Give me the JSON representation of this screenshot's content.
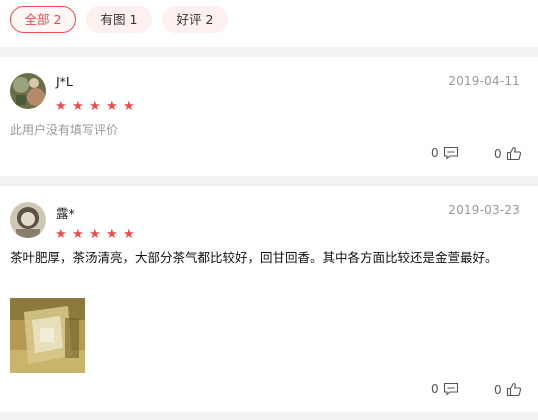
{
  "filters": [
    {
      "label": "全部 2",
      "active": true
    },
    {
      "label": "有图 1",
      "active": false
    },
    {
      "label": "好评 2",
      "active": false
    }
  ],
  "reviews": [
    {
      "user": "J*L",
      "date": "2019-04-11",
      "rating": 5,
      "text": "此用户没有填写评价",
      "has_photo": false,
      "comments": "0",
      "likes": "0"
    },
    {
      "user": "露*",
      "date": "2019-03-23",
      "rating": 5,
      "text": "茶叶肥厚，茶汤清亮，大部分茶气都比较好，回甘回香。其中各方面比较还是金萱最好。",
      "has_photo": true,
      "comments": "0",
      "likes": "0"
    }
  ],
  "colors": {
    "accent": "#ee4a4a",
    "muted_text": "#999999",
    "background": "#f2f2f2"
  },
  "icons": {
    "star": "star-icon",
    "comment": "comment-icon",
    "like": "thumbs-up-icon"
  }
}
